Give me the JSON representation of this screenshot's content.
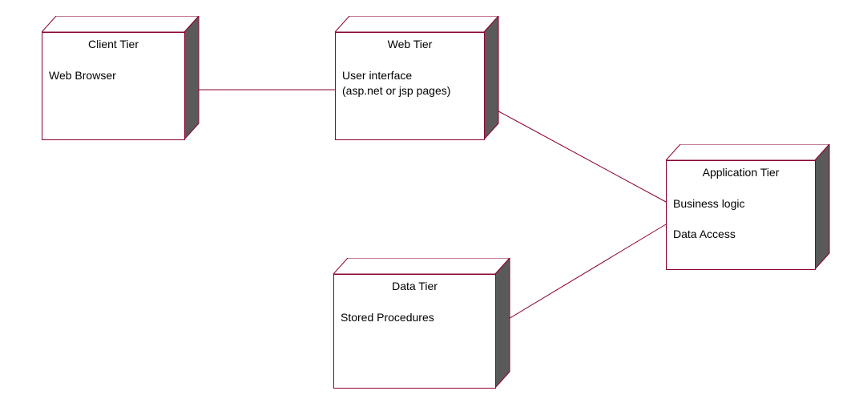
{
  "nodes": {
    "client": {
      "title": "Client Tier",
      "content": "Web Browser"
    },
    "web": {
      "title": "Web Tier",
      "content": "User interface\n(asp.net or jsp pages)"
    },
    "app": {
      "title": "Application Tier",
      "content": "Business logic\n\nData Access"
    },
    "data": {
      "title": "Data Tier",
      "content": "Stored Procedures"
    }
  },
  "colors": {
    "stroke": "#8b0033",
    "side_fill": "#5a5a5a",
    "top_fill": "#ffffff"
  },
  "connectors": [
    {
      "from": "client",
      "to": "web"
    },
    {
      "from": "web",
      "to": "app"
    },
    {
      "from": "data",
      "to": "app"
    }
  ]
}
